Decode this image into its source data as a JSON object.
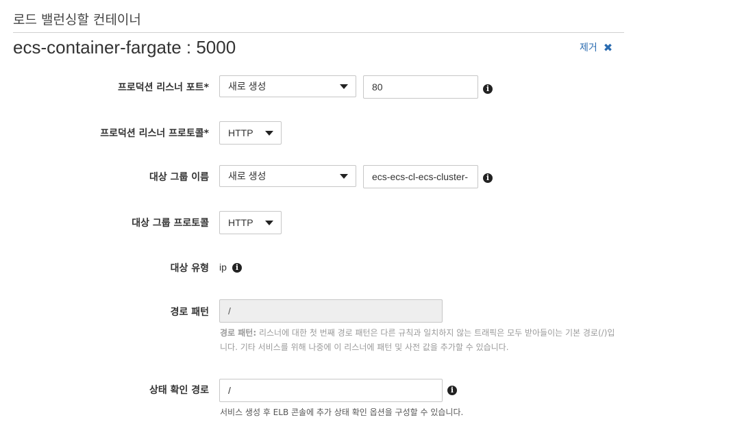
{
  "section": {
    "title": "로드 밸런싱할 컨테이너"
  },
  "container": {
    "title": "ecs-container-fargate : 5000",
    "remove_label": "제거"
  },
  "form": {
    "listener_port": {
      "label": "프로덕션 리스너 포트*",
      "select_value": "새로 생성",
      "input_value": "80"
    },
    "listener_protocol": {
      "label": "프로덕션 리스너 프로토콜*",
      "select_value": "HTTP"
    },
    "target_group_name": {
      "label": "대상 그룹 이름",
      "select_value": "새로 생성",
      "input_value": "ecs-ecs-cl-ecs-cluster-"
    },
    "target_group_protocol": {
      "label": "대상 그룹 프로토콜",
      "select_value": "HTTP"
    },
    "target_type": {
      "label": "대상 유형",
      "value": "ip"
    },
    "path_pattern": {
      "label": "경로 패턴",
      "input_value": "/",
      "help_bold": "경로 패턴:",
      "help_text": " 리스너에 대한 첫 번째 경로 패턴은 다른 규칙과 일치하지 않는 트래픽은 모두 받아들이는 기본 경로(/)입니다. 기타 서비스를 위해 나중에 이 리스너에 패턴 및 사전 값을 추가할 수 있습니다."
    },
    "health_check_path": {
      "label": "상태 확인 경로",
      "input_value": "/",
      "help_text": "서비스 생성 후 ELB 콘솔에 추가 상태 확인 옵션을 구성할 수 있습니다."
    }
  },
  "icons": {
    "info": "i"
  },
  "colors": {
    "link": "#2a6bb0",
    "border": "#c6c6c6",
    "disabled_bg": "#eeeeee",
    "help_text": "#9a9a9a"
  }
}
